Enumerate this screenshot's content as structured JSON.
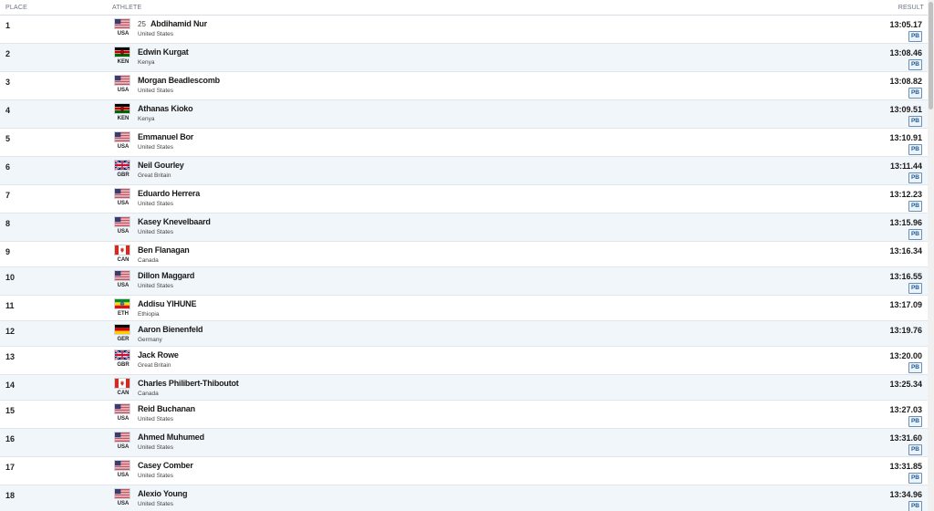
{
  "header": {
    "place": "PLACE",
    "athlete": "ATHLETE",
    "result": "RESULT"
  },
  "colors": {
    "pb_border": "#6b8fb5",
    "row_alt": "#f1f6fb"
  },
  "rows": [
    {
      "place": "1",
      "bib": "25",
      "name": "Abdihamid Nur",
      "code": "USA",
      "country": "United States",
      "time": "13:05.17",
      "pb": "PB",
      "flag": "usa-flag"
    },
    {
      "place": "2",
      "bib": "",
      "name": "Edwin Kurgat",
      "code": "KEN",
      "country": "Kenya",
      "time": "13:08.46",
      "pb": "PB",
      "flag": "kenya-flag"
    },
    {
      "place": "3",
      "bib": "",
      "name": "Morgan Beadlescomb",
      "code": "USA",
      "country": "United States",
      "time": "13:08.82",
      "pb": "PB",
      "flag": "usa-flag"
    },
    {
      "place": "4",
      "bib": "",
      "name": "Athanas Kioko",
      "code": "KEN",
      "country": "Kenya",
      "time": "13:09.51",
      "pb": "PB",
      "flag": "kenya-flag"
    },
    {
      "place": "5",
      "bib": "",
      "name": "Emmanuel Bor",
      "code": "USA",
      "country": "United States",
      "time": "13:10.91",
      "pb": "PB",
      "flag": "usa-flag"
    },
    {
      "place": "6",
      "bib": "",
      "name": "Neil Gourley",
      "code": "GBR",
      "country": "Great Britain",
      "time": "13:11.44",
      "pb": "PB",
      "flag": "gbr-flag"
    },
    {
      "place": "7",
      "bib": "",
      "name": "Eduardo Herrera",
      "code": "USA",
      "country": "United States",
      "time": "13:12.23",
      "pb": "PB",
      "flag": "usa-flag"
    },
    {
      "place": "8",
      "bib": "",
      "name": "Kasey Knevelbaard",
      "code": "USA",
      "country": "United States",
      "time": "13:15.96",
      "pb": "PB",
      "flag": "usa-flag"
    },
    {
      "place": "9",
      "bib": "",
      "name": "Ben Flanagan",
      "code": "CAN",
      "country": "Canada",
      "time": "13:16.34",
      "pb": "",
      "flag": "canada-flag"
    },
    {
      "place": "10",
      "bib": "",
      "name": "Dillon Maggard",
      "code": "USA",
      "country": "United States",
      "time": "13:16.55",
      "pb": "PB",
      "flag": "usa-flag"
    },
    {
      "place": "11",
      "bib": "",
      "name": "Addisu YIHUNE",
      "code": "ETH",
      "country": "Ethiopia",
      "time": "13:17.09",
      "pb": "",
      "flag": "ethiopia-flag"
    },
    {
      "place": "12",
      "bib": "",
      "name": "Aaron Bienenfeld",
      "code": "GER",
      "country": "Germany",
      "time": "13:19.76",
      "pb": "",
      "flag": "germany-flag"
    },
    {
      "place": "13",
      "bib": "",
      "name": "Jack Rowe",
      "code": "GBR",
      "country": "Great Britain",
      "time": "13:20.00",
      "pb": "PB",
      "flag": "gbr-flag"
    },
    {
      "place": "14",
      "bib": "",
      "name": "Charles Philibert-Thiboutot",
      "code": "CAN",
      "country": "Canada",
      "time": "13:25.34",
      "pb": "",
      "flag": "canada-flag"
    },
    {
      "place": "15",
      "bib": "",
      "name": "Reid Buchanan",
      "code": "USA",
      "country": "United States",
      "time": "13:27.03",
      "pb": "PB",
      "flag": "usa-flag"
    },
    {
      "place": "16",
      "bib": "",
      "name": "Ahmed Muhumed",
      "code": "USA",
      "country": "United States",
      "time": "13:31.60",
      "pb": "PB",
      "flag": "usa-flag"
    },
    {
      "place": "17",
      "bib": "",
      "name": "Casey Comber",
      "code": "USA",
      "country": "United States",
      "time": "13:31.85",
      "pb": "PB",
      "flag": "usa-flag"
    },
    {
      "place": "18",
      "bib": "",
      "name": "Alexio Young",
      "code": "USA",
      "country": "United States",
      "time": "13:34.96",
      "pb": "PB",
      "flag": "usa-flag"
    }
  ]
}
